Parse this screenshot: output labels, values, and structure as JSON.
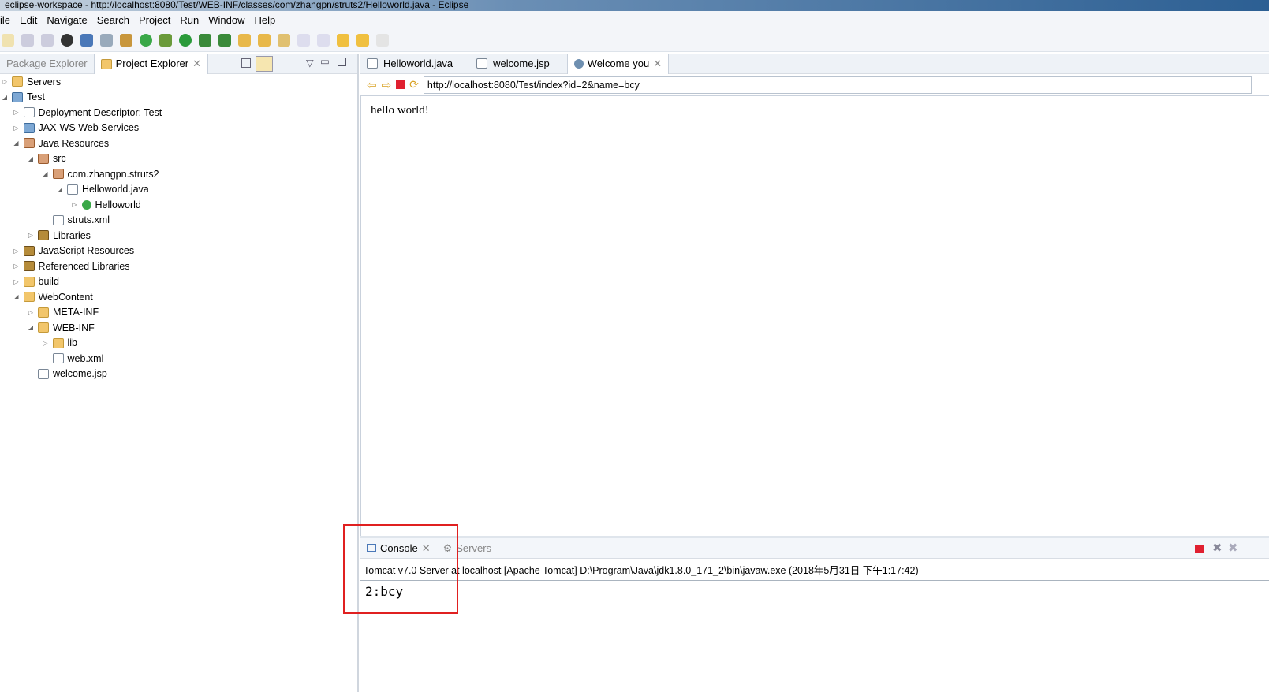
{
  "window": {
    "title": "eclipse-workspace - http://localhost:8080/Test/WEB-INF/classes/com/zhangpn/struts2/Helloworld.java - Eclipse"
  },
  "menu": [
    "ile",
    "Edit",
    "Navigate",
    "Search",
    "Project",
    "Run",
    "Window",
    "Help"
  ],
  "left": {
    "tabs": [
      "Package Explorer",
      "Project Explorer"
    ],
    "tree": [
      {
        "label": "Servers",
        "depth": 0,
        "tw": "▷",
        "icon": "folder"
      },
      {
        "label": "Test",
        "depth": 0,
        "tw": "◢",
        "icon": "proj"
      },
      {
        "label": "Deployment Descriptor: Test",
        "depth": 1,
        "tw": "▷",
        "icon": "file"
      },
      {
        "label": "JAX-WS Web Services",
        "depth": 1,
        "tw": "▷",
        "icon": "proj"
      },
      {
        "label": "Java Resources",
        "depth": 1,
        "tw": "◢",
        "icon": "pkg"
      },
      {
        "label": "src",
        "depth": 2,
        "tw": "◢",
        "icon": "pkg"
      },
      {
        "label": "com.zhangpn.struts2",
        "depth": 3,
        "tw": "◢",
        "icon": "pkg"
      },
      {
        "label": "Helloworld.java",
        "depth": 4,
        "tw": "◢",
        "icon": "file"
      },
      {
        "label": "Helloworld",
        "depth": 5,
        "tw": "▷",
        "icon": "cls"
      },
      {
        "label": "struts.xml",
        "depth": 3,
        "tw": "",
        "icon": "file"
      },
      {
        "label": "Libraries",
        "depth": 2,
        "tw": "▷",
        "icon": "lib"
      },
      {
        "label": "JavaScript Resources",
        "depth": 1,
        "tw": "▷",
        "icon": "lib"
      },
      {
        "label": "Referenced Libraries",
        "depth": 1,
        "tw": "▷",
        "icon": "lib"
      },
      {
        "label": "build",
        "depth": 1,
        "tw": "▷",
        "icon": "folder"
      },
      {
        "label": "WebContent",
        "depth": 1,
        "tw": "◢",
        "icon": "folder"
      },
      {
        "label": "META-INF",
        "depth": 2,
        "tw": "▷",
        "icon": "folder"
      },
      {
        "label": "WEB-INF",
        "depth": 2,
        "tw": "◢",
        "icon": "folder"
      },
      {
        "label": "lib",
        "depth": 3,
        "tw": "▷",
        "icon": "folder"
      },
      {
        "label": "web.xml",
        "depth": 3,
        "tw": "",
        "icon": "file"
      },
      {
        "label": "welcome.jsp",
        "depth": 2,
        "tw": "",
        "icon": "file"
      }
    ]
  },
  "editor": {
    "tabs": [
      "Helloworld.java",
      "welcome.jsp",
      "Welcome you"
    ],
    "url": "http://localhost:8080/Test/index?id=2&name=bcy",
    "content": "hello world!"
  },
  "console": {
    "tabs": [
      "Console",
      "Servers"
    ],
    "header": "Tomcat v7.0 Server at localhost [Apache Tomcat] D:\\Program\\Java\\jdk1.8.0_171_2\\bin\\javaw.exe (2018年5月31日 下午1:17:42)",
    "output": "2:bcy"
  },
  "colors": {
    "highlight": "#e02020",
    "stop": "#e02030"
  }
}
